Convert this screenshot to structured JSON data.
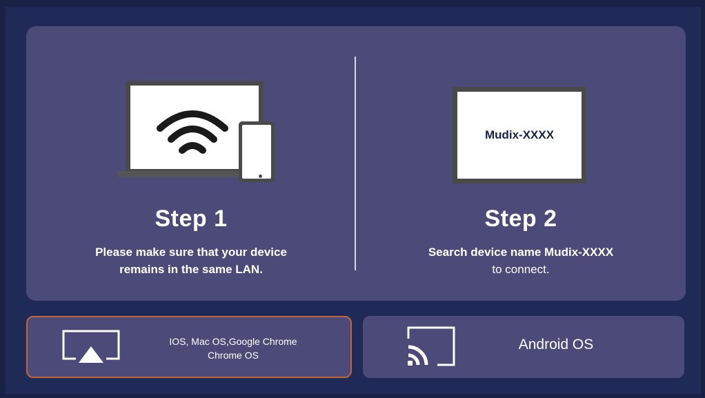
{
  "step1": {
    "title": "Step 1",
    "desc_line1": "Please make sure that your device",
    "desc_line2": "remains in the same LAN.",
    "icon": "laptop-phone-wifi-icon"
  },
  "step2": {
    "title": "Step 2",
    "tv_label": "Mudix-XXXX",
    "desc_line1": "Search device name Mudix-XXXX",
    "desc_line2": "to connect.",
    "icon": "tv-icon"
  },
  "options": {
    "airplay": {
      "line1": "IOS, Mac OS,Google Chrome",
      "line2": "Chrome OS",
      "icon": "airplay-icon",
      "selected": true
    },
    "cast": {
      "label": "Android OS",
      "icon": "cast-icon"
    }
  },
  "colors": {
    "background": "#1f2a56",
    "panel": "#4b4a78",
    "selected_border": "#c0663a",
    "text": "#ffffff"
  }
}
